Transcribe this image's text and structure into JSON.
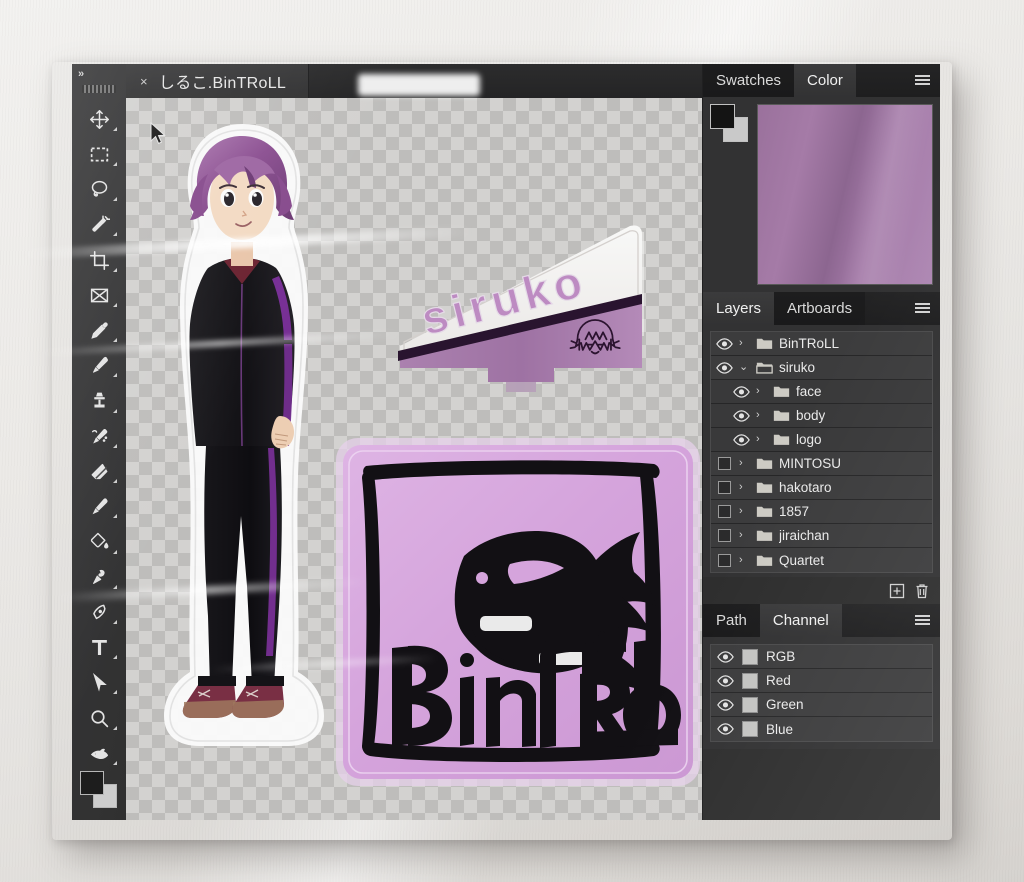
{
  "scene": {
    "description": "Photograph of an acrylic standee printed with a Photoshop-style interface",
    "backdrop_color": "#ecebe8"
  },
  "toolbar": {
    "collapse_label": "»",
    "tools": [
      {
        "name": "move-tool",
        "icon": "move-icon"
      },
      {
        "name": "rectangular-marquee-tool",
        "icon": "marquee-icon"
      },
      {
        "name": "lasso-tool",
        "icon": "lasso-icon"
      },
      {
        "name": "magic-wand-tool",
        "icon": "magic-wand-icon"
      },
      {
        "name": "crop-tool",
        "icon": "crop-icon"
      },
      {
        "name": "slice-tool",
        "icon": "frame-icon"
      },
      {
        "name": "eyedropper-tool",
        "icon": "eyedropper-icon"
      },
      {
        "name": "brush-tool",
        "icon": "brush-icon"
      },
      {
        "name": "clone-stamp-tool",
        "icon": "stamp-icon"
      },
      {
        "name": "history-brush-tool",
        "icon": "history-brush-icon"
      },
      {
        "name": "eraser-tool",
        "icon": "eraser-icon"
      },
      {
        "name": "blur-tool",
        "icon": "blur-brush-icon"
      },
      {
        "name": "gradient-tool",
        "icon": "paint-bucket-icon"
      },
      {
        "name": "dodge-tool",
        "icon": "dodge-icon"
      },
      {
        "name": "pen-tool",
        "icon": "pen-icon"
      },
      {
        "name": "type-tool",
        "icon": "type-t-icon"
      },
      {
        "name": "path-selection-tool",
        "icon": "arrow-pointer-icon"
      },
      {
        "name": "zoom-tool",
        "icon": "magnifier-icon"
      },
      {
        "name": "hand-tool",
        "icon": "fish-hand-icon"
      }
    ],
    "foreground_color": "#1d1d1d",
    "background_color": "#cfcfcf"
  },
  "document": {
    "tab_close_glyph": "×",
    "tab_title": "しるこ.BinTRoLL"
  },
  "artwork": {
    "character": {
      "name": "siruko",
      "hair_color": "#9c5fa0",
      "jacket_color": "#17161a",
      "stripe_color": "#7a2f9a",
      "shoe_color": "#7d2f45"
    },
    "nameplate": {
      "text": "siruko",
      "plate_top_color": "#f2f0ee",
      "plate_bottom_color": "#a97bad",
      "stripe_color": "#2a1430",
      "text_color": "#c08cc6"
    },
    "logo": {
      "text": "BinTRoLL",
      "plate_color": "#dba9e2",
      "ink_color": "#111013"
    }
  },
  "color_panel": {
    "tabs": [
      {
        "label": "Swatches",
        "active": false
      },
      {
        "label": "Color",
        "active": true
      }
    ],
    "menu_icon": "hamburger-menu-icon",
    "foreground_color": "#141414",
    "background_color": "#cbcbcb",
    "picker_color": "#a276a8"
  },
  "layers_panel": {
    "tabs": [
      {
        "label": "Layers",
        "active": true
      },
      {
        "label": "Artboards",
        "active": false
      }
    ],
    "menu_icon": "hamburger-menu-icon",
    "rows": [
      {
        "name": "BinTRoLL",
        "visible": true,
        "expanded": false,
        "indent": 0
      },
      {
        "name": "siruko",
        "visible": true,
        "expanded": true,
        "indent": 0
      },
      {
        "name": "face",
        "visible": true,
        "expanded": false,
        "indent": 1
      },
      {
        "name": "body",
        "visible": true,
        "expanded": false,
        "indent": 1
      },
      {
        "name": "logo",
        "visible": true,
        "expanded": false,
        "indent": 1
      },
      {
        "name": "MINTOSU",
        "visible": false,
        "expanded": false,
        "indent": 0
      },
      {
        "name": "hakotaro",
        "visible": false,
        "expanded": false,
        "indent": 0
      },
      {
        "name": "1857",
        "visible": false,
        "expanded": false,
        "indent": 0
      },
      {
        "name": "jiraichan",
        "visible": false,
        "expanded": false,
        "indent": 0
      },
      {
        "name": "Quartet",
        "visible": false,
        "expanded": false,
        "indent": 0
      }
    ],
    "actions": [
      {
        "name": "new-layer-button",
        "icon": "plus-square-icon"
      },
      {
        "name": "delete-layer-button",
        "icon": "trash-icon"
      }
    ]
  },
  "channel_panel": {
    "tabs": [
      {
        "label": "Path",
        "active": false
      },
      {
        "label": "Channel",
        "active": true
      }
    ],
    "menu_icon": "hamburger-menu-icon",
    "rows": [
      {
        "name": "RGB",
        "visible": true
      },
      {
        "name": "Red",
        "visible": true
      },
      {
        "name": "Green",
        "visible": true
      },
      {
        "name": "Blue",
        "visible": true
      }
    ]
  }
}
